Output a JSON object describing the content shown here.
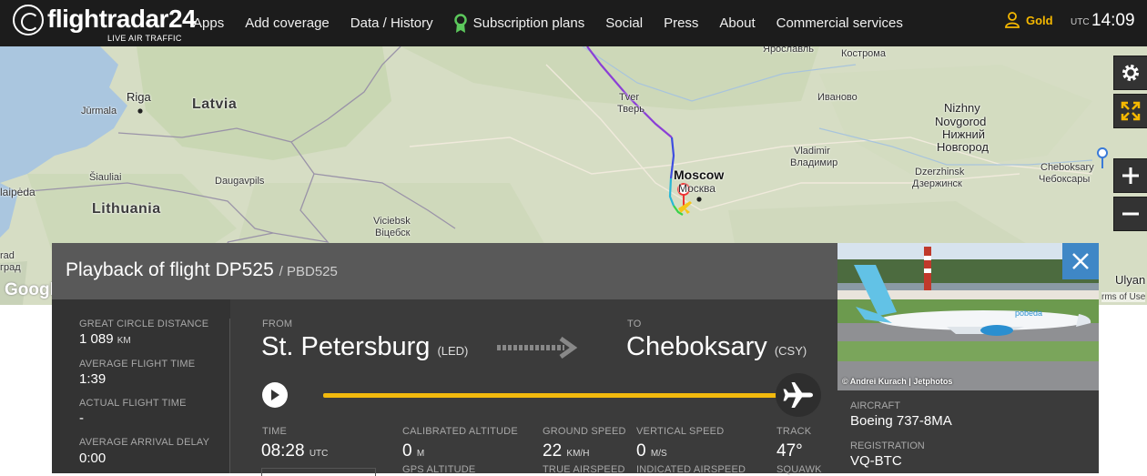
{
  "header": {
    "logo_text": "flightradar24",
    "logo_tagline": "LIVE AIR TRAFFIC",
    "nav": [
      "Apps",
      "Add coverage",
      "Data / History",
      "Subscription plans",
      "Social",
      "Press",
      "About",
      "Commercial services"
    ],
    "account_label": "Gold",
    "timezone": "UTC",
    "time": "14:09"
  },
  "map": {
    "labels": {
      "riga": "Riga",
      "jurmala": "Jūrmala",
      "latvia": "Latvia",
      "lithuania": "Lithuania",
      "siauliai": "Šiauliai",
      "daugavpils": "Daugavpils",
      "klaipeda": "laipėda",
      "viciebsk": "Viciebsk",
      "viciebsk_cyr": "Віцебск",
      "tver": "Tver",
      "tver_cyr": "Тверь",
      "moscow": "Moscow",
      "moscow_cyr": "Москва",
      "yaroslavl": "Ярославль",
      "kostroma": "Кострома",
      "ivanovo": "Иваново",
      "vladimir": "Vladimir",
      "vladimir_cyr": "Владимир",
      "nizhny1": "Nizhny",
      "nizhny2": "Novgorod",
      "nizhny_cyr1": "Нижний",
      "nizhny_cyr2": "Новгород",
      "dzerzhinsk": "Dzerzhinsk",
      "dzerzhinsk_cyr": "Дзержинск",
      "cheboksary": "Cheboksary",
      "cheboksary_cyr": "Чебоксары",
      "ulyan": "Ulyan",
      "grad1": "rad",
      "grad2": "град"
    },
    "google_mark": "Google",
    "terms": "rms of Use"
  },
  "panel": {
    "title": "Playback of flight DP525",
    "callsign": "/ PBD525",
    "stats": [
      {
        "label": "GREAT CIRCLE DISTANCE",
        "value": "1 089",
        "unit": "KM"
      },
      {
        "label": "AVERAGE FLIGHT TIME",
        "value": "1:39",
        "unit": ""
      },
      {
        "label": "ACTUAL FLIGHT TIME",
        "value": "-",
        "unit": ""
      },
      {
        "label": "AVERAGE ARRIVAL DELAY",
        "value": "0:00",
        "unit": ""
      }
    ],
    "from_label": "FROM",
    "from_city": "St. Petersburg",
    "from_code": "(LED)",
    "to_label": "TO",
    "to_city": "Cheboksary",
    "to_code": "(CSY)",
    "playback_progress": 1.0,
    "time_label": "TIME",
    "time_value": "08:28",
    "time_unit": "UTC",
    "cal_alt_label": "CALIBRATED ALTITUDE",
    "cal_alt_value": "0",
    "cal_alt_unit": "M",
    "gps_alt_label": "GPS ALTITUDE",
    "gs_label": "GROUND SPEED",
    "gs_value": "22",
    "gs_unit": "KM/H",
    "tas_label": "TRUE AIRSPEED",
    "vs_label": "VERTICAL SPEED",
    "vs_value": "0",
    "vs_unit": "M/S",
    "ias_label": "INDICATED AIRSPEED",
    "track_label": "TRACK",
    "track_value": "47°",
    "squawk_label": "SQUAWK"
  },
  "aircraft": {
    "photo_credit": "© Andrei Kurach | Jetphotos",
    "livery_text": "pobeda",
    "aircraft_label": "AIRCRAFT",
    "aircraft_value": "Boeing 737-8MA",
    "registration_label": "REGISTRATION",
    "registration_value": "VQ-BTC"
  },
  "colors": {
    "topbar": "#1c1c1c",
    "panel": "#3b3b3b",
    "progress": "#f2b90d",
    "close_button": "#3f87c6",
    "gold": "#f5b800"
  }
}
